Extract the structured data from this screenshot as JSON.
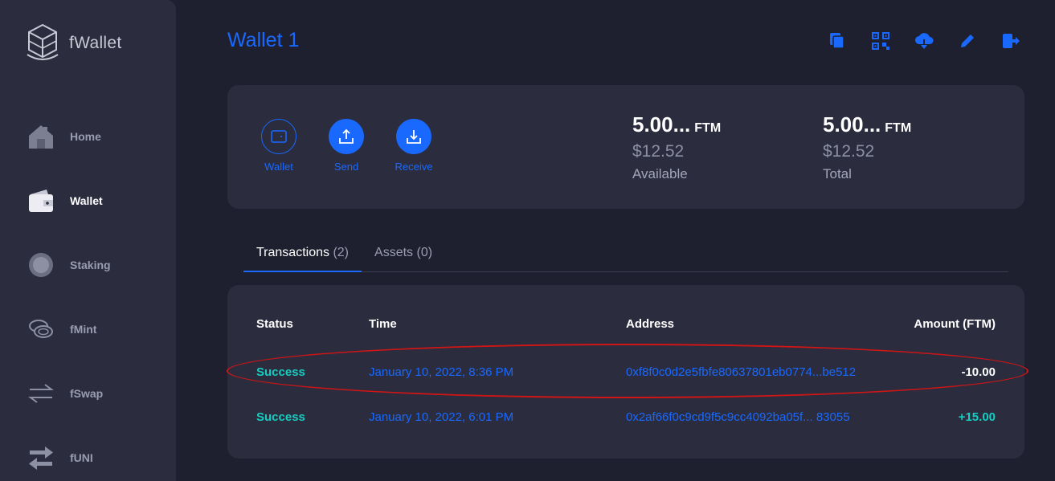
{
  "app": {
    "name": "fWallet"
  },
  "sidebar": {
    "items": [
      {
        "label": "Home",
        "icon": "home-icon"
      },
      {
        "label": "Wallet",
        "icon": "wallet-icon",
        "active": true
      },
      {
        "label": "Staking",
        "icon": "staking-icon"
      },
      {
        "label": "fMint",
        "icon": "coins-icon"
      },
      {
        "label": "fSwap",
        "icon": "swap-icon"
      },
      {
        "label": "fUNI",
        "icon": "exchange-icon"
      }
    ]
  },
  "header": {
    "title": "Wallet 1",
    "toolbar": [
      "copy-icon",
      "qr-code-icon",
      "cloud-download-icon",
      "edit-icon",
      "logout-icon"
    ]
  },
  "balance_card": {
    "actions": [
      {
        "label": "Wallet",
        "icon": "wallet-icon"
      },
      {
        "label": "Send",
        "icon": "upload-icon"
      },
      {
        "label": "Receive",
        "icon": "download-icon"
      }
    ],
    "available": {
      "amount": "5.00...",
      "unit": "FTM",
      "usd": "$12.52",
      "caption": "Available"
    },
    "total": {
      "amount": "5.00...",
      "unit": "FTM",
      "usd": "$12.52",
      "caption": "Total"
    }
  },
  "tabs": [
    {
      "label": "Transactions",
      "count": "(2)",
      "active": true
    },
    {
      "label": "Assets",
      "count": "(0)",
      "active": false
    }
  ],
  "transactions": {
    "columns": [
      "Status",
      "Time",
      "Address",
      "Amount (FTM)"
    ],
    "rows": [
      {
        "status": "Success",
        "time": "January 10, 2022, 8:36 PM",
        "address": "0xf8f0c0d2e5fbfe80637801eb0774...be512",
        "amount": "-10.00"
      },
      {
        "status": "Success",
        "time": "January 10, 2022, 6:01 PM",
        "address": "0x2af66f0c9cd9f5c9cc4092ba05f... 83055",
        "amount": "+15.00"
      }
    ]
  },
  "colors": {
    "accent": "#1969ff",
    "success": "#15cdc0",
    "background": "#1f202f",
    "panel": "#2b2c3e",
    "annotation": "#d01515"
  }
}
